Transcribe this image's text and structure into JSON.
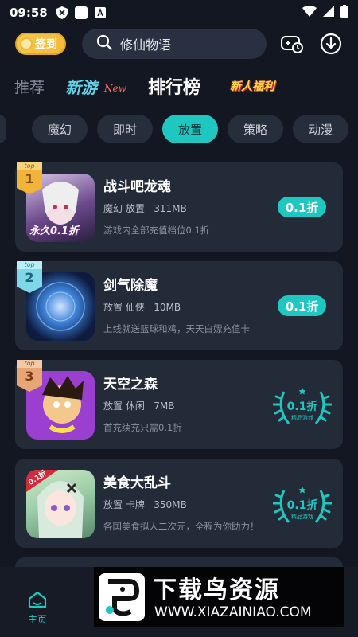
{
  "status": {
    "time": "09:58"
  },
  "header": {
    "checkin_label": "签到",
    "search_text": "修仙物语"
  },
  "tabs": [
    {
      "label": "推荐"
    },
    {
      "label": "新游",
      "sub": "New"
    },
    {
      "label": "排行榜"
    },
    {
      "label": "新人福利"
    }
  ],
  "chips": [
    {
      "label": "魔幻"
    },
    {
      "label": "即时"
    },
    {
      "label": "放置",
      "active": true
    },
    {
      "label": "策略"
    },
    {
      "label": "动漫"
    }
  ],
  "games": [
    {
      "rank": "1",
      "badge_text": "top",
      "name": "战斗吧龙魂",
      "tags": "魔幻 放置",
      "size": "311MB",
      "desc": "游戏内全部充值档位0.1折",
      "discount": "0.1折",
      "style": "pill",
      "thumb_text": "永久0.1折"
    },
    {
      "rank": "2",
      "badge_text": "top",
      "name": "剑气除魔",
      "tags": "放置 仙侠",
      "size": "10MB",
      "desc": "上线就送篮球和鸡，天天白嫖充值卡",
      "discount": "0.1折",
      "style": "pill"
    },
    {
      "rank": "3",
      "badge_text": "top",
      "name": "天空之森",
      "tags": "放置 休闲",
      "size": "7MB",
      "desc": "首充续充只需0.1折",
      "discount": "0.1折",
      "style": "laurel",
      "laurel_sub": "精品游戏"
    },
    {
      "name": "美食大乱斗",
      "tags": "放置 卡牌",
      "size": "350MB",
      "desc": "各国美食拟人二次元，全程为你助力！",
      "discount": "0.1折",
      "style": "laurel",
      "laurel_sub": "精品游戏",
      "corner": "0.1折"
    }
  ],
  "bottom": {
    "home_label": "主页"
  },
  "watermark": {
    "title": "下载鸟资源",
    "url": "WWW.XIAZAINIAO.COM"
  },
  "colors": {
    "accent": "#1ec8c0",
    "background": "#121722",
    "card": "#232a38"
  }
}
